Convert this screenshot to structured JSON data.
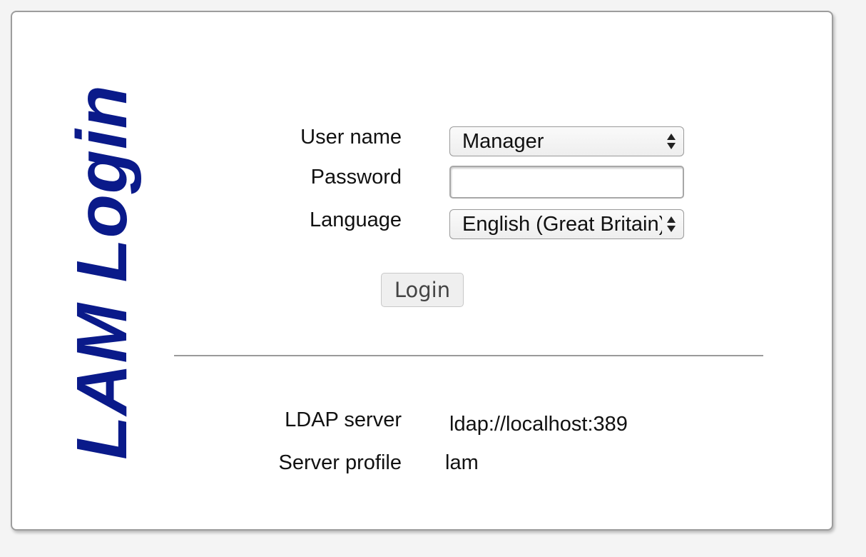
{
  "title": "LAM Login",
  "form": {
    "username_label": "User name",
    "username_value": "Manager",
    "password_label": "Password",
    "password_value": "",
    "language_label": "Language",
    "language_value": "English (Great Britain)",
    "login_button_label": "Login"
  },
  "server_info": {
    "ldap_server_label": "LDAP server",
    "ldap_server_value": "ldap://localhost:389",
    "server_profile_label": "Server profile",
    "server_profile_value": "lam"
  },
  "colors": {
    "title": "#0a1a8a",
    "background": "#f4f4f4",
    "panel": "#ffffff"
  }
}
